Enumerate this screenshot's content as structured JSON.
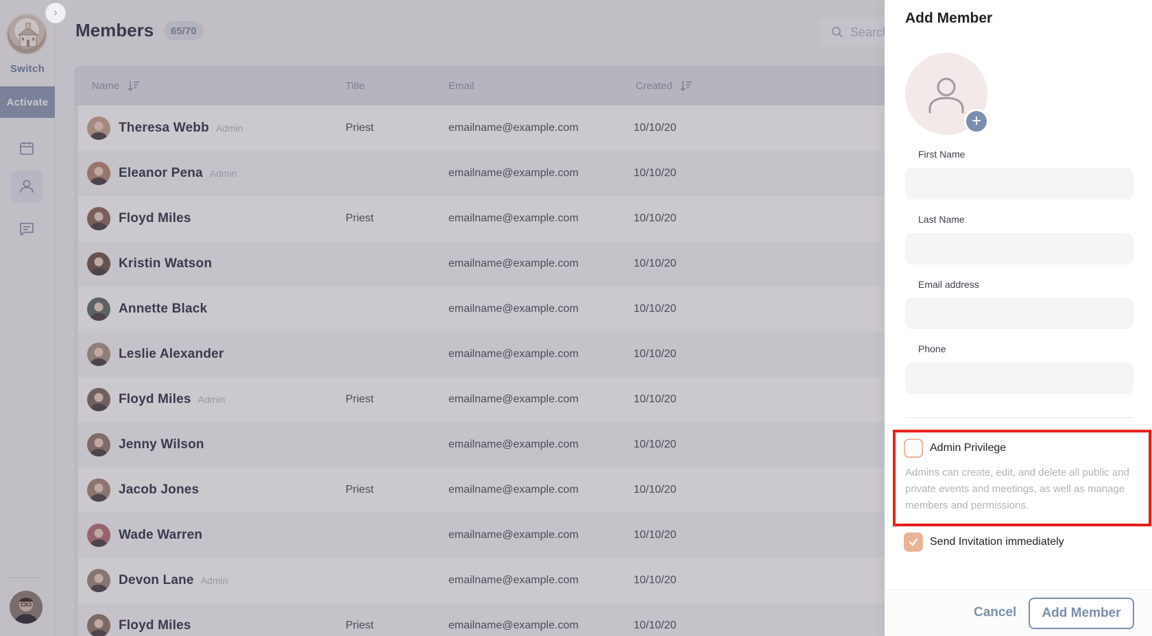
{
  "sidebar": {
    "switch_label": "Switch",
    "activate_label": "Activate",
    "nav": [
      {
        "icon": "calendar-icon"
      },
      {
        "icon": "user-icon",
        "active": true
      },
      {
        "icon": "chat-icon"
      }
    ]
  },
  "header": {
    "title": "Members",
    "count": "65/70",
    "search_placeholder": "Search"
  },
  "table": {
    "columns": {
      "name": "Name",
      "title": "Title",
      "email": "Email",
      "created": "Created"
    },
    "rows": [
      {
        "name": "Theresa Webb",
        "admin": "Admin",
        "title": "Priest",
        "email": "emailname@example.com",
        "created": "10/10/20"
      },
      {
        "name": "Eleanor Pena",
        "admin": "Admin",
        "title": "",
        "email": "emailname@example.com",
        "created": "10/10/20"
      },
      {
        "name": "Floyd Miles",
        "admin": "",
        "title": "Priest",
        "email": "emailname@example.com",
        "created": "10/10/20"
      },
      {
        "name": "Kristin Watson",
        "admin": "",
        "title": "",
        "email": "emailname@example.com",
        "created": "10/10/20"
      },
      {
        "name": "Annette Black",
        "admin": "",
        "title": "",
        "email": "emailname@example.com",
        "created": "10/10/20"
      },
      {
        "name": "Leslie Alexander",
        "admin": "",
        "title": "",
        "email": "emailname@example.com",
        "created": "10/10/20"
      },
      {
        "name": "Floyd Miles",
        "admin": "Admin",
        "title": "Priest",
        "email": "emailname@example.com",
        "created": "10/10/20"
      },
      {
        "name": "Jenny Wilson",
        "admin": "",
        "title": "",
        "email": "emailname@example.com",
        "created": "10/10/20"
      },
      {
        "name": "Jacob Jones",
        "admin": "",
        "title": "Priest",
        "email": "emailname@example.com",
        "created": "10/10/20"
      },
      {
        "name": "Wade Warren",
        "admin": "",
        "title": "",
        "email": "emailname@example.com",
        "created": "10/10/20"
      },
      {
        "name": "Devon Lane",
        "admin": "Admin",
        "title": "",
        "email": "emailname@example.com",
        "created": "10/10/20"
      },
      {
        "name": "Floyd Miles",
        "admin": "",
        "title": "Priest",
        "email": "emailname@example.com",
        "created": "10/10/20"
      }
    ]
  },
  "drawer": {
    "title": "Add Member",
    "first_name_label": "First Name",
    "first_name_value": "",
    "last_name_label": "Last Name",
    "last_name_value": "",
    "email_label": "Email address",
    "email_value": "",
    "phone_label": "Phone",
    "phone_value": "",
    "admin_privilege_label": "Admin Privilege",
    "admin_privilege_checked": false,
    "admin_description": "Admins can create, edit, and delete all public and private events and meetings, as well as manage members and permissions.",
    "send_invitation_label": "Send Invitation immediately",
    "send_invitation_checked": true,
    "cancel_label": "Cancel",
    "submit_label": "Add Member"
  },
  "colors": {
    "accent": "#7b8fae",
    "checkbox": "#e8b598",
    "highlight": "#e6201a",
    "avatar_palette": [
      "#c9a48a",
      "#b58870",
      "#8a6858",
      "#6f5548",
      "#5f6e68",
      "#a99587",
      "#7d6a60",
      "#93796b",
      "#a48876",
      "#b76e78",
      "#9d8a7c",
      "#8e7668"
    ]
  }
}
